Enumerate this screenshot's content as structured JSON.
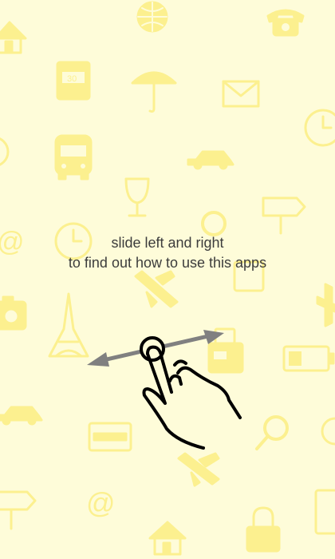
{
  "tutorial": {
    "line1": "slide left and right",
    "line2": "to find out how to use this apps"
  },
  "colors": {
    "background": "#fefcd9",
    "pattern_icons": "#fcf08f",
    "arrow": "#808080",
    "hand_stroke": "#000000",
    "text": "#3c3c3c"
  },
  "pattern_icons": [
    "house-icon",
    "globe-icon",
    "telephone-icon",
    "calendar-icon",
    "umbrella-icon",
    "envelope-icon",
    "clock-icon",
    "bus-icon",
    "car-icon",
    "wine-glass-icon",
    "signpost-icon",
    "at-sign-icon",
    "magnifier-icon",
    "airplane-icon",
    "camera-icon",
    "eiffel-tower-icon",
    "coffee-machine-icon",
    "battery-icon",
    "credit-card-icon",
    "padlock-icon"
  ],
  "gesture": {
    "hand": "hand-pointer-icon",
    "arrow": "double-arrow-icon",
    "direction": "horizontal swipe"
  }
}
